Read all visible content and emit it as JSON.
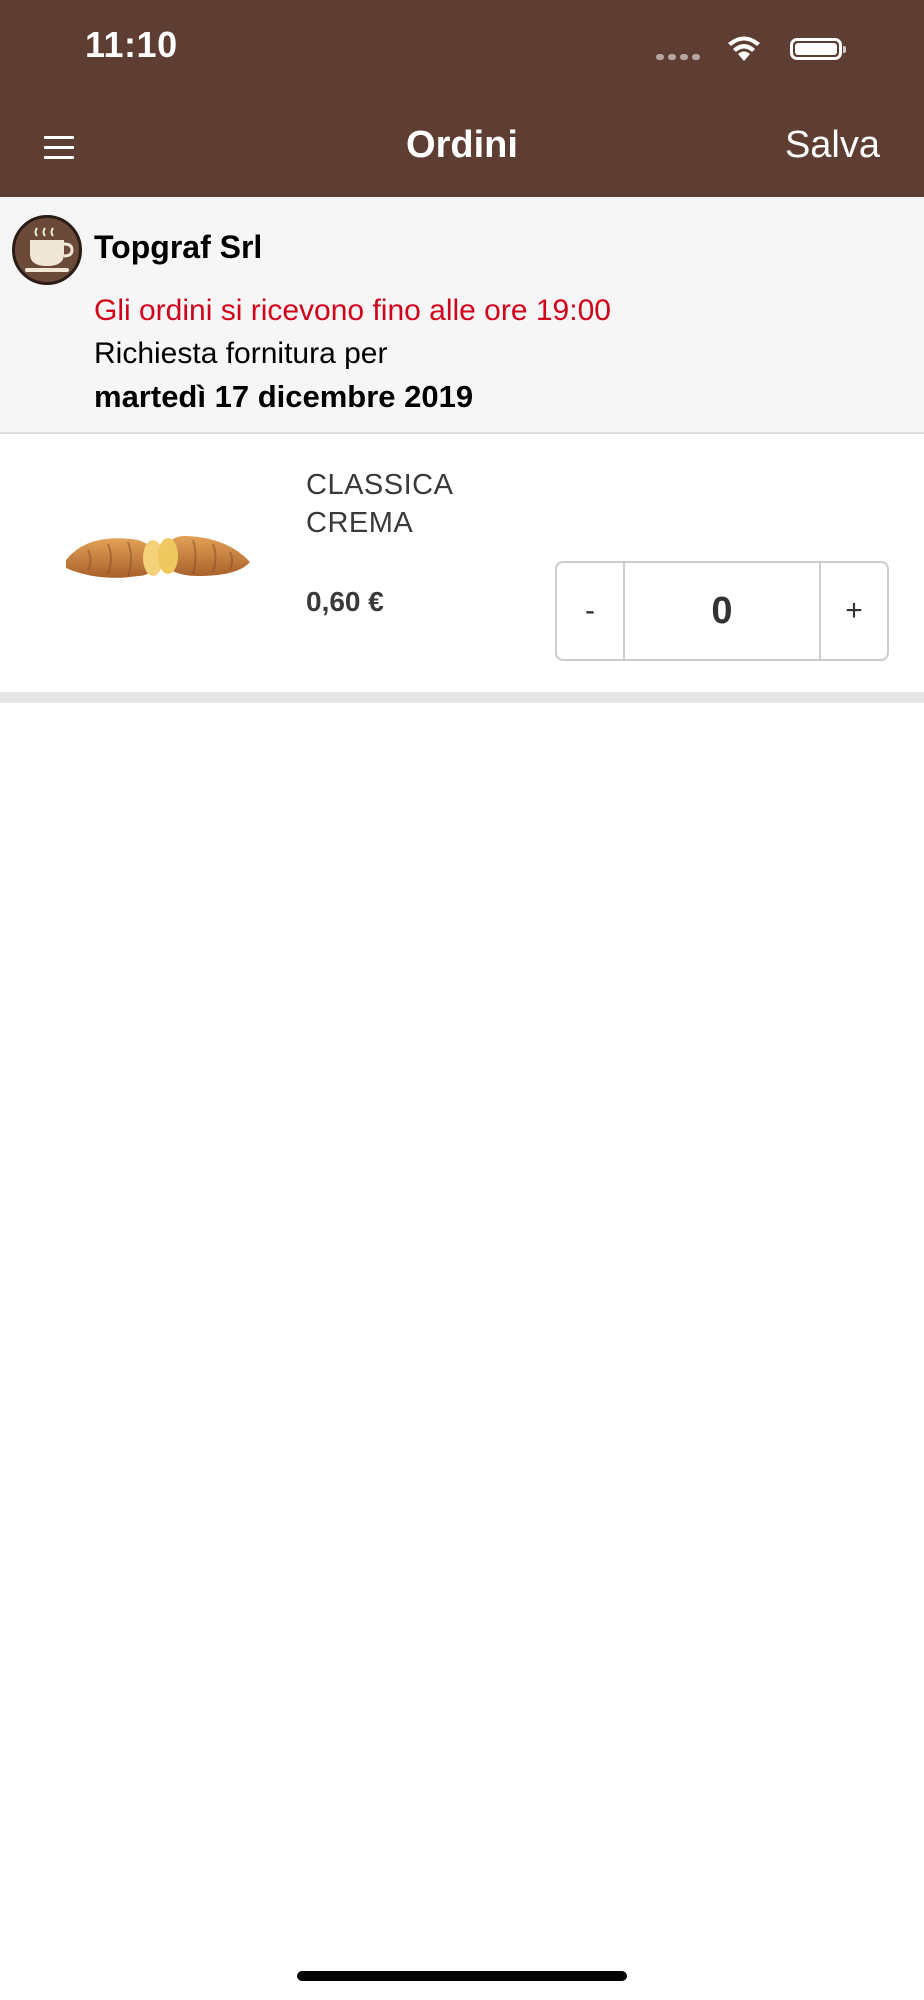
{
  "status_bar": {
    "time": "11:10",
    "icons": [
      "signal-icon",
      "wifi-icon",
      "battery-icon"
    ]
  },
  "nav": {
    "menu_icon": "hamburger-menu-icon",
    "title": "Ordini",
    "save_label": "Salva",
    "background_color": "#5e3d32"
  },
  "info": {
    "avatar_icon": "coffee-cup-icon",
    "company": "Topgraf Srl",
    "notice": "Gli ordini si ricevono fino alle ore 19:00",
    "notice_color": "#d0021b",
    "request_label": "Richiesta fornitura per",
    "date": "martedì 17 dicembre 2019"
  },
  "products": [
    {
      "image_icon": "croissant-image",
      "name_line1": "CLASSICA",
      "name_line2": "CREMA",
      "price": "0,60 €",
      "quantity": "0",
      "minus_label": "-",
      "plus_label": "+"
    }
  ]
}
